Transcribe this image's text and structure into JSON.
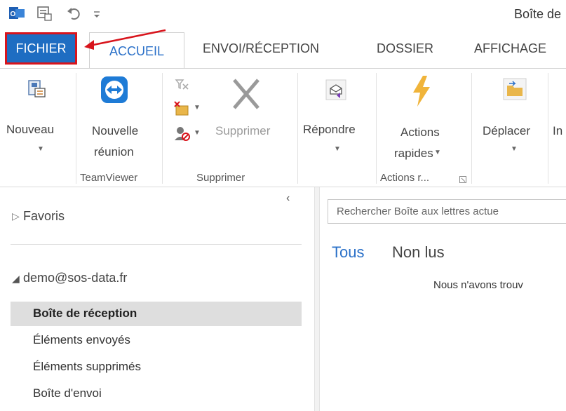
{
  "titlebar": {
    "window_title": "Boîte de",
    "icons": [
      "outlook-icon",
      "send-receive-icon",
      "undo-icon",
      "customize-toolbar-icon"
    ]
  },
  "tabs": [
    {
      "label": "FICHIER",
      "active": false,
      "highlighted": true
    },
    {
      "label": "ACCUEIL",
      "active": true
    },
    {
      "label": "ENVOI/RÉCEPTION",
      "active": false
    },
    {
      "label": "DOSSIER",
      "active": false
    },
    {
      "label": "AFFICHAGE",
      "active": false
    }
  ],
  "ribbon": {
    "new_label": "Nouveau",
    "new_meeting_line1": "Nouvelle",
    "new_meeting_line2": "réunion",
    "delete_label": "Supprimer",
    "reply_label": "Répondre",
    "quick_actions_line1": "Actions",
    "quick_actions_line2": "rapides",
    "move_label": "Déplacer",
    "cut_off_label": "In",
    "groups": {
      "teamviewer": "TeamViewer",
      "delete": "Supprimer",
      "quick_actions": "Actions r..."
    }
  },
  "nav": {
    "favorites": "Favoris",
    "account": "demo@sos-data.fr",
    "folders": [
      "Boîte de réception",
      "Éléments envoyés",
      "Éléments supprimés",
      "Boîte d'envoi"
    ],
    "collapse_icon": "‹"
  },
  "mail": {
    "search_placeholder": "Rechercher Boîte aux lettres actue",
    "filter_all": "Tous",
    "filter_unread": "Non lus",
    "empty_message": "Nous n'avons trouv"
  },
  "colors": {
    "file_tab_bg": "#1e6dc2",
    "highlight_red": "#d8141c",
    "accent_blue": "#2a70c8"
  }
}
